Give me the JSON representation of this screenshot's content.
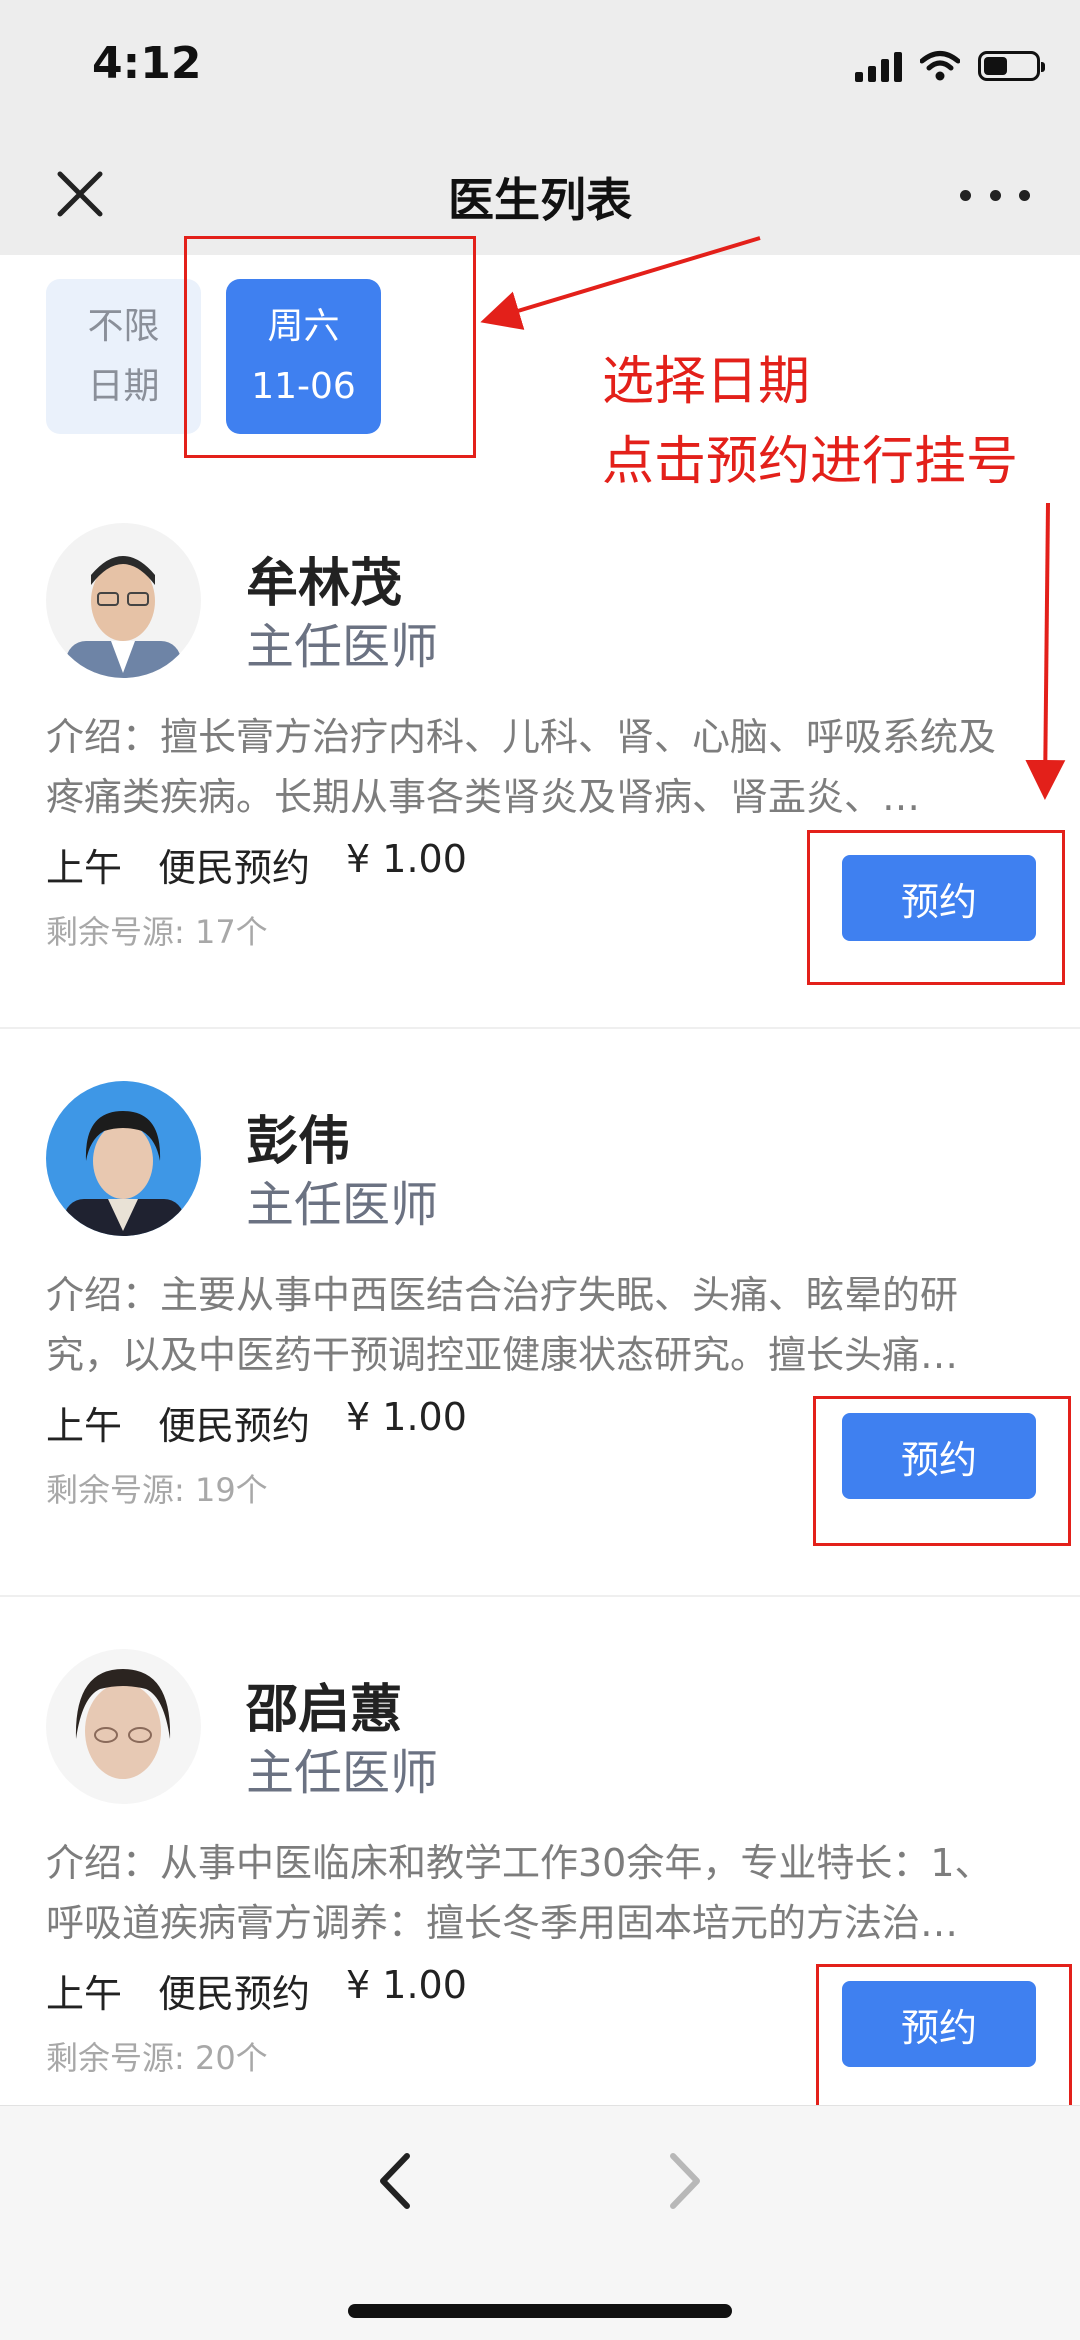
{
  "status_bar": {
    "time": "4:12",
    "battery_level": 0.45
  },
  "nav": {
    "title": "医生列表",
    "close_icon": "close-icon",
    "more_icon": "more-icon"
  },
  "date_tabs": [
    {
      "line1": "不限",
      "line2": "日期",
      "selected": false
    },
    {
      "line1": "周六",
      "line2": "11-06",
      "selected": true
    }
  ],
  "annotation": {
    "line1": "选择日期",
    "line2": "点击预约进行挂号",
    "color": "#e3201a"
  },
  "doctors": [
    {
      "name": "牟林茂",
      "title": "主任医师",
      "intro": "介绍：擅长膏方治疗内科、儿科、肾、心脑、呼吸系统及疼痛类疾病。长期从事各类肾炎及肾病、肾盂炎、…",
      "period": "上午",
      "type": "便民预约",
      "price": "¥ 1.00",
      "remaining": "剩余号源: 17个",
      "button": "预约"
    },
    {
      "name": "彭伟",
      "title": "主任医师",
      "intro": "介绍：主要从事中西医结合治疗失眠、头痛、眩晕的研究，以及中医药干预调控亚健康状态研究。擅长头痛…",
      "period": "上午",
      "type": "便民预约",
      "price": "¥ 1.00",
      "remaining": "剩余号源: 19个",
      "button": "预约"
    },
    {
      "name": "邵启蕙",
      "title": "主任医师",
      "intro": "介绍：从事中医临床和教学工作30余年，专业特长：1、呼吸道疾病膏方调养：擅长冬季用固本培元的方法治…",
      "period": "上午",
      "type": "便民预约",
      "price": "¥ 1.00",
      "remaining": "剩余号源: 20个",
      "button": "预约"
    }
  ],
  "colors": {
    "accent": "#3f80f0",
    "annotation_red": "#e3201a"
  },
  "bottom_bar": {
    "back_icon": "back-arrow-icon",
    "forward_icon": "forward-arrow-icon"
  }
}
